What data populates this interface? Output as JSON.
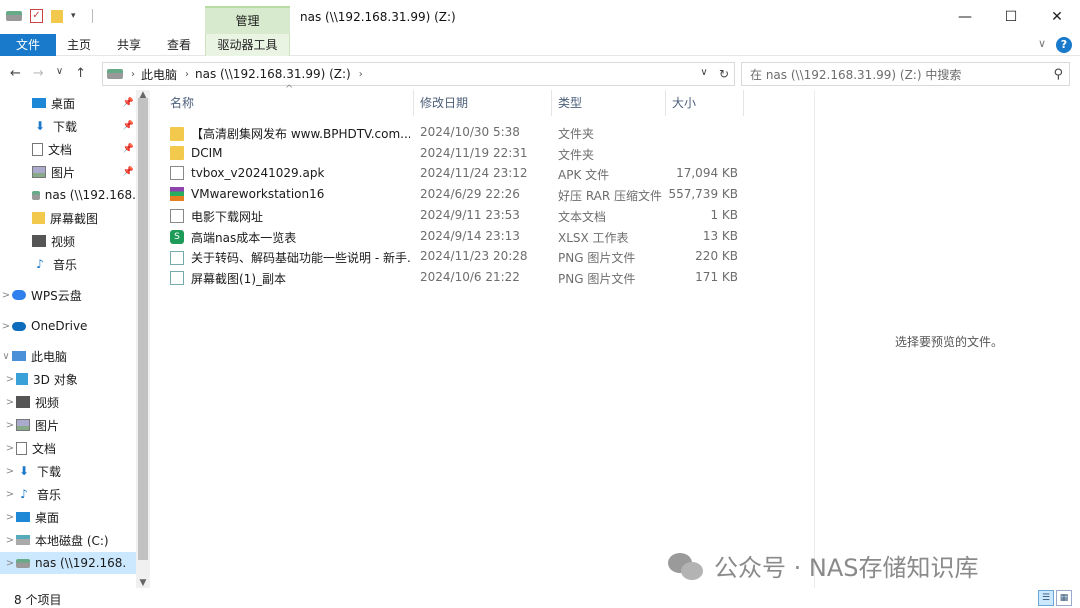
{
  "window": {
    "title": "nas (\\\\192.168.31.99) (Z:)",
    "context_tab": "管理",
    "controls": {
      "minimize": "—",
      "maximize": "☐",
      "close": "✕"
    }
  },
  "ribbon": {
    "tabs": [
      "文件",
      "主页",
      "共享",
      "查看",
      "驱动器工具"
    ],
    "expand": "∨",
    "help": "?"
  },
  "nav": {
    "back": "←",
    "forward": "→",
    "recent": "∨",
    "up": "↑",
    "breadcrumb": [
      "此电脑",
      "nas (\\\\192.168.31.99) (Z:)"
    ],
    "refresh": "↻",
    "search_placeholder": "在 nas (\\\\192.168.31.99) (Z:) 中搜索"
  },
  "sidebar": {
    "items": [
      {
        "label": "桌面",
        "icon": "desktop-icon",
        "pinned": true,
        "expander": ""
      },
      {
        "label": "下载",
        "icon": "download-icon",
        "pinned": true,
        "expander": ""
      },
      {
        "label": "文档",
        "icon": "document-icon",
        "pinned": true,
        "expander": ""
      },
      {
        "label": "图片",
        "icon": "picture-icon",
        "pinned": true,
        "expander": ""
      },
      {
        "label": "nas (\\\\192.168.",
        "icon": "network-drive-icon",
        "pinned": false,
        "expander": ""
      },
      {
        "label": "屏幕截图",
        "icon": "folder-icon",
        "pinned": false,
        "expander": ""
      },
      {
        "label": "视频",
        "icon": "video-icon",
        "pinned": false,
        "expander": ""
      },
      {
        "label": "音乐",
        "icon": "music-icon",
        "pinned": false,
        "expander": ""
      },
      {
        "label": "WPS云盘",
        "icon": "wps-cloud-icon",
        "pinned": false,
        "expander": ">"
      },
      {
        "label": "OneDrive",
        "icon": "onedrive-icon",
        "pinned": false,
        "expander": ">"
      },
      {
        "label": "此电脑",
        "icon": "this-pc-icon",
        "pinned": false,
        "expander": "∨"
      },
      {
        "label": "3D 对象",
        "icon": "3d-objects-icon",
        "pinned": false,
        "expander": ">"
      },
      {
        "label": "视频",
        "icon": "video-icon",
        "pinned": false,
        "expander": ">"
      },
      {
        "label": "图片",
        "icon": "picture-icon",
        "pinned": false,
        "expander": ">"
      },
      {
        "label": "文档",
        "icon": "document-icon",
        "pinned": false,
        "expander": ">"
      },
      {
        "label": "下载",
        "icon": "download-icon",
        "pinned": false,
        "expander": ">"
      },
      {
        "label": "音乐",
        "icon": "music-icon",
        "pinned": false,
        "expander": ">"
      },
      {
        "label": "桌面",
        "icon": "desktop-icon",
        "pinned": false,
        "expander": ">"
      },
      {
        "label": "本地磁盘 (C:)",
        "icon": "local-disk-icon",
        "pinned": false,
        "expander": ">"
      },
      {
        "label": "nas (\\\\192.168.",
        "icon": "network-drive-icon",
        "pinned": false,
        "expander": ">",
        "selected": true
      }
    ]
  },
  "columns": {
    "name": "名称",
    "date": "修改日期",
    "type": "类型",
    "size": "大小"
  },
  "files": [
    {
      "name": "【高清剧集网发布 www.BPHDTV.com...",
      "date": "2024/10/30 5:38",
      "type": "文件夹",
      "size": "",
      "icon": "folder-icon"
    },
    {
      "name": "DCIM",
      "date": "2024/11/19 22:31",
      "type": "文件夹",
      "size": "",
      "icon": "folder-icon"
    },
    {
      "name": "tvbox_v20241029.apk",
      "date": "2024/11/24 23:12",
      "type": "APK 文件",
      "size": "17,094 KB",
      "icon": "file-icon"
    },
    {
      "name": "VMwareworkstation16",
      "date": "2024/6/29 22:26",
      "type": "好压 RAR 压缩文件",
      "size": "557,739 KB",
      "icon": "rar-icon"
    },
    {
      "name": "电影下载网址",
      "date": "2024/9/11 23:53",
      "type": "文本文档",
      "size": "1 KB",
      "icon": "text-file-icon"
    },
    {
      "name": "高端nas成本一览表",
      "date": "2024/9/14 23:13",
      "type": "XLSX 工作表",
      "size": "13 KB",
      "icon": "xlsx-icon"
    },
    {
      "name": "关于转码、解码基础功能一些说明 - 新手...",
      "date": "2024/11/23 20:28",
      "type": "PNG 图片文件",
      "size": "220 KB",
      "icon": "png-icon"
    },
    {
      "name": "屏幕截图(1)_副本",
      "date": "2024/10/6 21:22",
      "type": "PNG 图片文件",
      "size": "171 KB",
      "icon": "png-icon"
    }
  ],
  "preview": {
    "message": "选择要预览的文件。"
  },
  "watermark": {
    "text": "公众号 · NAS存储知识库"
  },
  "status": {
    "count": "8 个项目"
  },
  "colors": {
    "accent": "#1979ca",
    "context_tab": "#d7eacd",
    "selection": "#cce8ff"
  }
}
